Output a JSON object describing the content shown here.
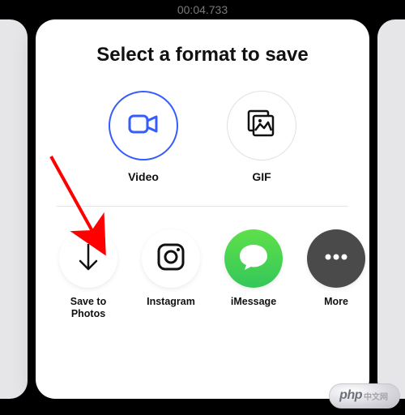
{
  "timecode": "00:04.733",
  "title": "Select a format to save",
  "formats": {
    "video": {
      "label": "Video",
      "selected": true
    },
    "gif": {
      "label": "GIF",
      "selected": false
    }
  },
  "share": {
    "save_to_photos": {
      "label": "Save to\nPhotos"
    },
    "instagram": {
      "label": "Instagram"
    },
    "imessage": {
      "label": "iMessage"
    },
    "more": {
      "label": "More"
    }
  },
  "annotation": {
    "arrow_color": "#ff0000"
  },
  "watermark": {
    "brand": "php",
    "suffix": "中文网"
  }
}
